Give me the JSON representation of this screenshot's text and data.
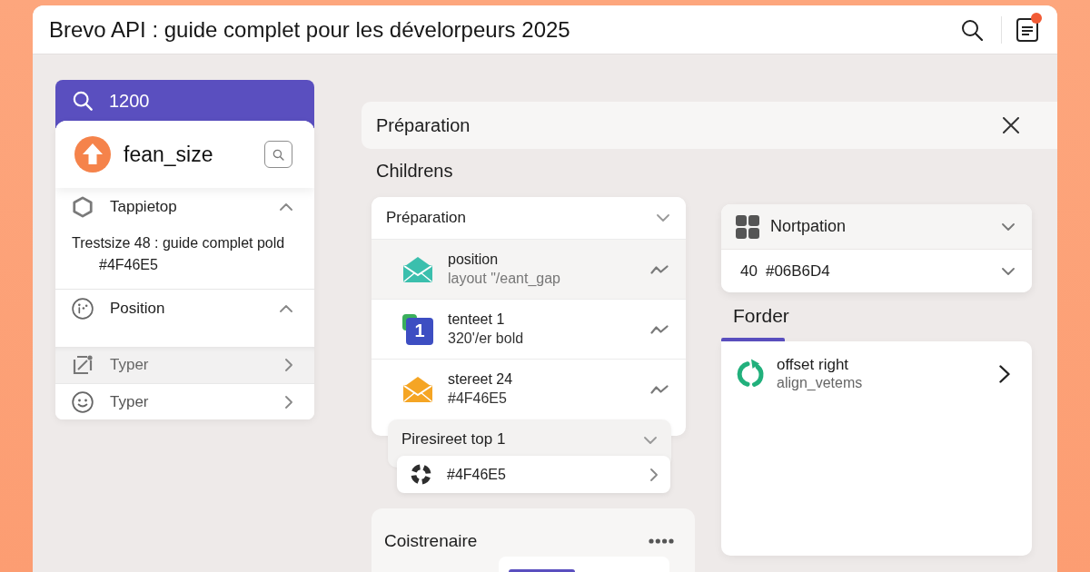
{
  "window": {
    "title": "Brevo API : guide complet pour les dévelorpeurs 2025",
    "has_notification": true
  },
  "sidebar": {
    "search": {
      "value": "1200"
    },
    "profile": {
      "name": "fean_size"
    },
    "sections": [
      {
        "label": "Tappietop",
        "expanded": true,
        "lines": [
          "Trestsize 48 : guide complet pold",
          "#4F46E5"
        ]
      },
      {
        "label": "Position",
        "expanded": true
      }
    ],
    "items": [
      {
        "label": "Typer",
        "selected": true
      },
      {
        "label": "Typer",
        "selected": false
      }
    ]
  },
  "main": {
    "header": {
      "title": "Préparation"
    },
    "heading": "Childrens",
    "accordion": {
      "title": "Préparation",
      "items": [
        {
          "kind": "mail",
          "color": "#3bbfad",
          "title": "position",
          "subtitle": "layout \"/eant_gap",
          "selected": true
        },
        {
          "kind": "number",
          "badge": "1",
          "title": "tenteet 1",
          "subtitle": "320'/er bold",
          "selected": false
        },
        {
          "kind": "mail",
          "color": "#f5a524",
          "title": "stereet 24",
          "subtitle": "#4F46E5",
          "selected": false
        }
      ]
    },
    "group": {
      "title": "Piresireet top 1",
      "items": [
        {
          "label": "#4F46E5"
        }
      ]
    },
    "container": {
      "title": "Coistrenaire"
    }
  },
  "right": {
    "select": {
      "title": "Nortpation",
      "number": "40",
      "value": "#06B6D4"
    },
    "tabs": [
      {
        "label": "Forder",
        "selected": true
      }
    ],
    "list": [
      {
        "title": "offset right",
        "subtitle": "align_vetems"
      }
    ]
  }
}
